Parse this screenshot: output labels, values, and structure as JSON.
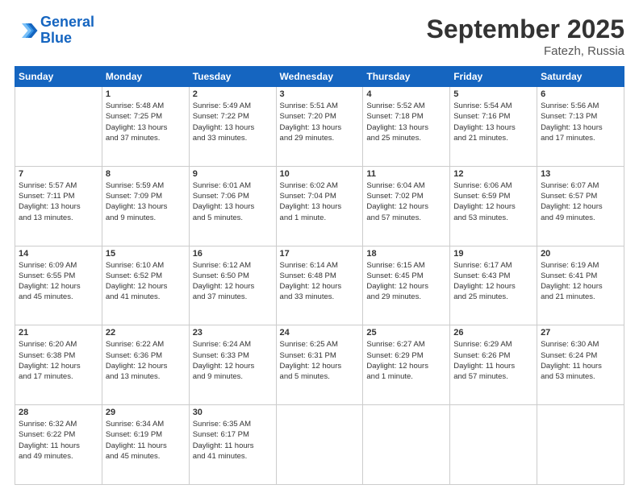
{
  "header": {
    "logo_line1": "General",
    "logo_line2": "Blue",
    "month": "September 2025",
    "location": "Fatezh, Russia"
  },
  "days_of_week": [
    "Sunday",
    "Monday",
    "Tuesday",
    "Wednesday",
    "Thursday",
    "Friday",
    "Saturday"
  ],
  "weeks": [
    [
      {
        "day": "",
        "info": ""
      },
      {
        "day": "1",
        "info": "Sunrise: 5:48 AM\nSunset: 7:25 PM\nDaylight: 13 hours\nand 37 minutes."
      },
      {
        "day": "2",
        "info": "Sunrise: 5:49 AM\nSunset: 7:22 PM\nDaylight: 13 hours\nand 33 minutes."
      },
      {
        "day": "3",
        "info": "Sunrise: 5:51 AM\nSunset: 7:20 PM\nDaylight: 13 hours\nand 29 minutes."
      },
      {
        "day": "4",
        "info": "Sunrise: 5:52 AM\nSunset: 7:18 PM\nDaylight: 13 hours\nand 25 minutes."
      },
      {
        "day": "5",
        "info": "Sunrise: 5:54 AM\nSunset: 7:16 PM\nDaylight: 13 hours\nand 21 minutes."
      },
      {
        "day": "6",
        "info": "Sunrise: 5:56 AM\nSunset: 7:13 PM\nDaylight: 13 hours\nand 17 minutes."
      }
    ],
    [
      {
        "day": "7",
        "info": "Sunrise: 5:57 AM\nSunset: 7:11 PM\nDaylight: 13 hours\nand 13 minutes."
      },
      {
        "day": "8",
        "info": "Sunrise: 5:59 AM\nSunset: 7:09 PM\nDaylight: 13 hours\nand 9 minutes."
      },
      {
        "day": "9",
        "info": "Sunrise: 6:01 AM\nSunset: 7:06 PM\nDaylight: 13 hours\nand 5 minutes."
      },
      {
        "day": "10",
        "info": "Sunrise: 6:02 AM\nSunset: 7:04 PM\nDaylight: 13 hours\nand 1 minute."
      },
      {
        "day": "11",
        "info": "Sunrise: 6:04 AM\nSunset: 7:02 PM\nDaylight: 12 hours\nand 57 minutes."
      },
      {
        "day": "12",
        "info": "Sunrise: 6:06 AM\nSunset: 6:59 PM\nDaylight: 12 hours\nand 53 minutes."
      },
      {
        "day": "13",
        "info": "Sunrise: 6:07 AM\nSunset: 6:57 PM\nDaylight: 12 hours\nand 49 minutes."
      }
    ],
    [
      {
        "day": "14",
        "info": "Sunrise: 6:09 AM\nSunset: 6:55 PM\nDaylight: 12 hours\nand 45 minutes."
      },
      {
        "day": "15",
        "info": "Sunrise: 6:10 AM\nSunset: 6:52 PM\nDaylight: 12 hours\nand 41 minutes."
      },
      {
        "day": "16",
        "info": "Sunrise: 6:12 AM\nSunset: 6:50 PM\nDaylight: 12 hours\nand 37 minutes."
      },
      {
        "day": "17",
        "info": "Sunrise: 6:14 AM\nSunset: 6:48 PM\nDaylight: 12 hours\nand 33 minutes."
      },
      {
        "day": "18",
        "info": "Sunrise: 6:15 AM\nSunset: 6:45 PM\nDaylight: 12 hours\nand 29 minutes."
      },
      {
        "day": "19",
        "info": "Sunrise: 6:17 AM\nSunset: 6:43 PM\nDaylight: 12 hours\nand 25 minutes."
      },
      {
        "day": "20",
        "info": "Sunrise: 6:19 AM\nSunset: 6:41 PM\nDaylight: 12 hours\nand 21 minutes."
      }
    ],
    [
      {
        "day": "21",
        "info": "Sunrise: 6:20 AM\nSunset: 6:38 PM\nDaylight: 12 hours\nand 17 minutes."
      },
      {
        "day": "22",
        "info": "Sunrise: 6:22 AM\nSunset: 6:36 PM\nDaylight: 12 hours\nand 13 minutes."
      },
      {
        "day": "23",
        "info": "Sunrise: 6:24 AM\nSunset: 6:33 PM\nDaylight: 12 hours\nand 9 minutes."
      },
      {
        "day": "24",
        "info": "Sunrise: 6:25 AM\nSunset: 6:31 PM\nDaylight: 12 hours\nand 5 minutes."
      },
      {
        "day": "25",
        "info": "Sunrise: 6:27 AM\nSunset: 6:29 PM\nDaylight: 12 hours\nand 1 minute."
      },
      {
        "day": "26",
        "info": "Sunrise: 6:29 AM\nSunset: 6:26 PM\nDaylight: 11 hours\nand 57 minutes."
      },
      {
        "day": "27",
        "info": "Sunrise: 6:30 AM\nSunset: 6:24 PM\nDaylight: 11 hours\nand 53 minutes."
      }
    ],
    [
      {
        "day": "28",
        "info": "Sunrise: 6:32 AM\nSunset: 6:22 PM\nDaylight: 11 hours\nand 49 minutes."
      },
      {
        "day": "29",
        "info": "Sunrise: 6:34 AM\nSunset: 6:19 PM\nDaylight: 11 hours\nand 45 minutes."
      },
      {
        "day": "30",
        "info": "Sunrise: 6:35 AM\nSunset: 6:17 PM\nDaylight: 11 hours\nand 41 minutes."
      },
      {
        "day": "",
        "info": ""
      },
      {
        "day": "",
        "info": ""
      },
      {
        "day": "",
        "info": ""
      },
      {
        "day": "",
        "info": ""
      }
    ]
  ]
}
